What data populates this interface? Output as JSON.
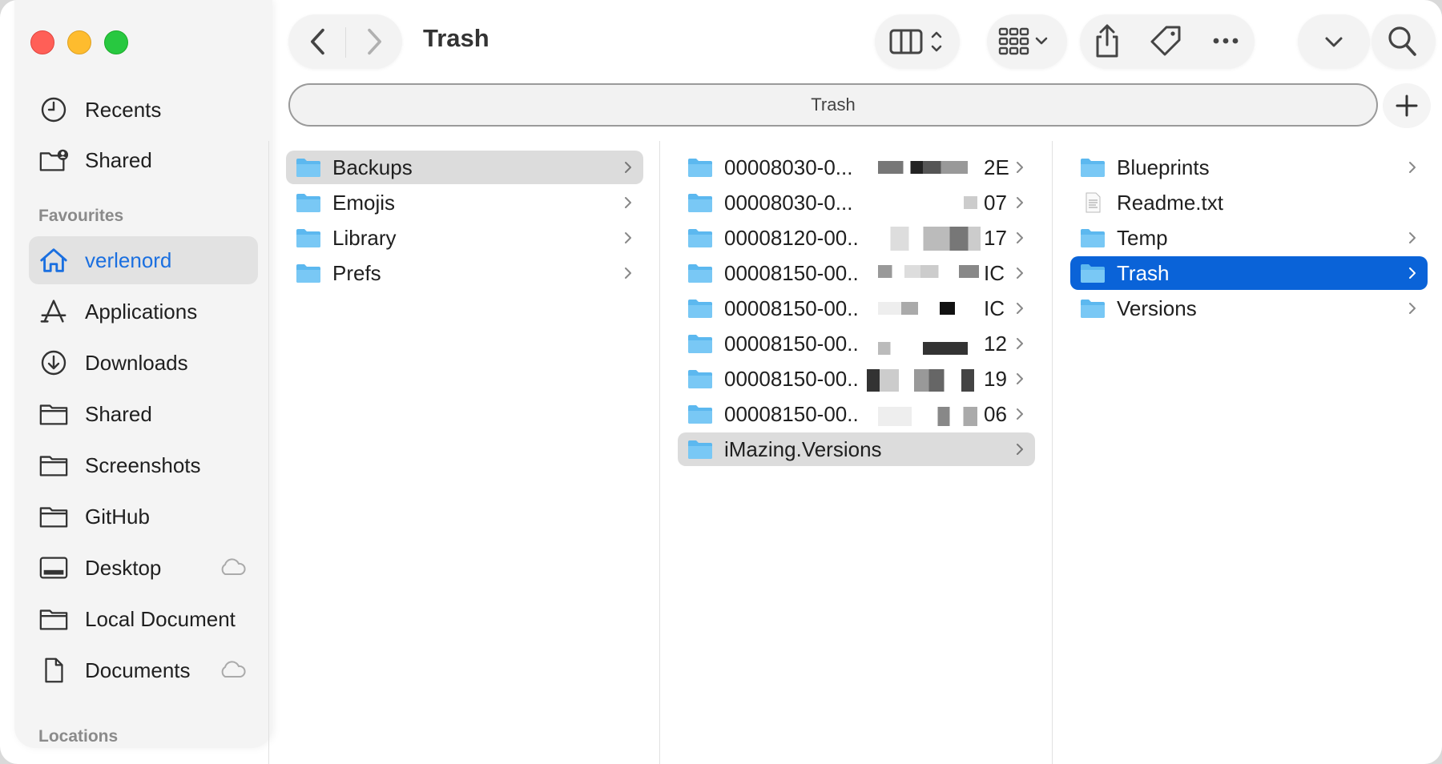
{
  "window": {
    "title": "Trash"
  },
  "pathbar": {
    "path": "Trash"
  },
  "sidebar": {
    "recents": "Recents",
    "shared_top": "Shared",
    "favourites_heading": "Favourites",
    "items": [
      {
        "label": "verlenord",
        "icon": "home-icon",
        "selected": true
      },
      {
        "label": "Applications",
        "icon": "applications-icon"
      },
      {
        "label": "Downloads",
        "icon": "downloads-icon"
      },
      {
        "label": "Shared",
        "icon": "folder-icon"
      },
      {
        "label": "Screenshots",
        "icon": "folder-icon"
      },
      {
        "label": "GitHub",
        "icon": "folder-icon"
      },
      {
        "label": "Desktop",
        "icon": "desktop-icon",
        "cloud": true
      },
      {
        "label": "Local Document",
        "icon": "folder-icon"
      },
      {
        "label": "Documents",
        "icon": "document-icon",
        "cloud": true
      }
    ],
    "locations_heading": "Locations"
  },
  "columns": {
    "col1": [
      {
        "label": "Backups",
        "selected": true
      },
      {
        "label": "Emojis"
      },
      {
        "label": "Library"
      },
      {
        "label": "Prefs"
      }
    ],
    "col2": [
      {
        "label": "00008030-0...",
        "suffix": "2E"
      },
      {
        "label": "00008030-0...",
        "suffix": "07"
      },
      {
        "label": "00008120-00..",
        "suffix": "17"
      },
      {
        "label": "00008150-00..",
        "suffix": "IC"
      },
      {
        "label": "00008150-00..",
        "suffix": "IC"
      },
      {
        "label": "00008150-00..",
        "suffix": "12"
      },
      {
        "label": "00008150-00..",
        "suffix": "19"
      },
      {
        "label": "00008150-00..",
        "suffix": "06"
      },
      {
        "label": "iMazing.Versions",
        "selected": true
      }
    ],
    "col3": [
      {
        "label": "Blueprints",
        "type": "folder"
      },
      {
        "label": "Readme.txt",
        "type": "file"
      },
      {
        "label": "Temp",
        "type": "folder"
      },
      {
        "label": "Trash",
        "type": "folder",
        "selected": true
      },
      {
        "label": "Versions",
        "type": "folder"
      }
    ]
  },
  "colors": {
    "accent": "#0a63d8",
    "folder": "#4fb3ef"
  }
}
